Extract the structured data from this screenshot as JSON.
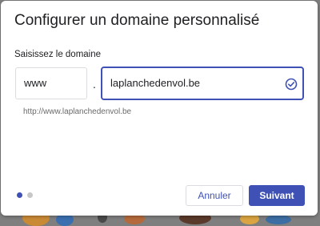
{
  "dialog": {
    "title": "Configurer un domaine personnalisé",
    "domain_label": "Saisissez le domaine",
    "subdomain_value": "www",
    "separator": ".",
    "domain_value": "laplanchedenvol.be",
    "url_preview": "http://www.laplanchedenvol.be",
    "steps": {
      "current": 1,
      "total": 2
    },
    "buttons": {
      "cancel": "Annuler",
      "next": "Suivant"
    }
  },
  "colors": {
    "accent": "#3f51b5",
    "inactive_step": "#c7c7c7"
  },
  "icons": {
    "validation": "check-circle-icon"
  }
}
